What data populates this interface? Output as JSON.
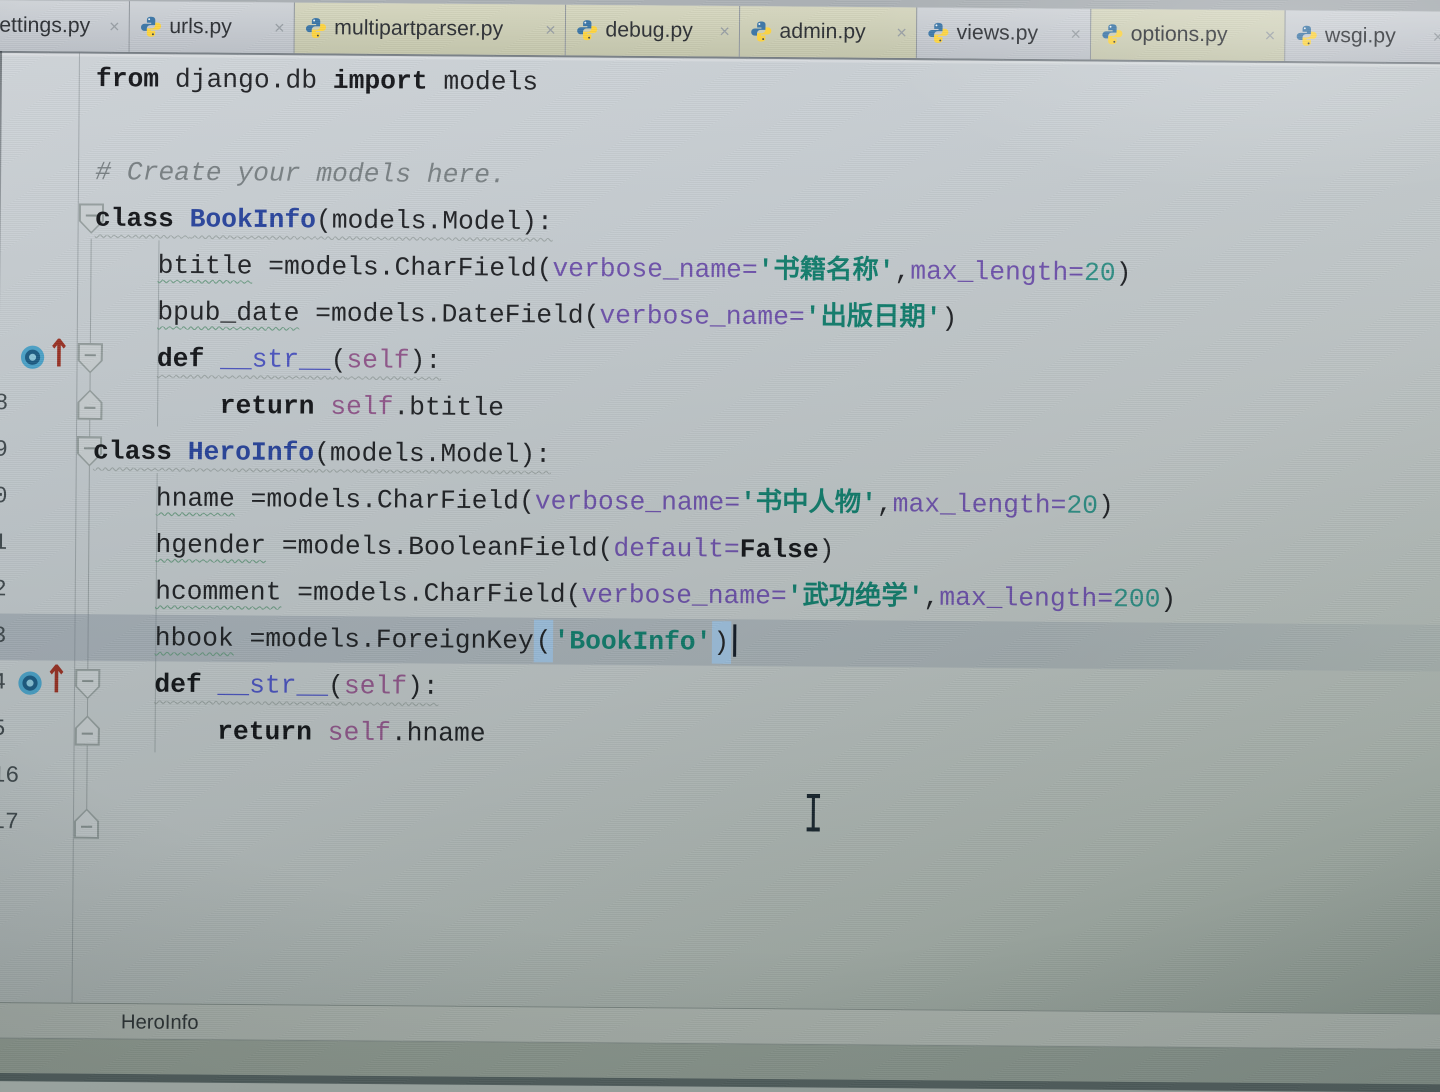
{
  "tabs": [
    {
      "label": "ettings.py",
      "icon": false,
      "tint": "gray",
      "close": "×"
    },
    {
      "label": "urls.py",
      "icon": true,
      "tint": "gray",
      "close": "×"
    },
    {
      "label": "multipartparser.py",
      "icon": true,
      "tint": "yellow",
      "close": "×"
    },
    {
      "label": "debug.py",
      "icon": true,
      "tint": "yellow",
      "close": "×"
    },
    {
      "label": "admin.py",
      "icon": true,
      "tint": "yellow",
      "close": "×"
    },
    {
      "label": "views.py",
      "icon": true,
      "tint": "gray",
      "close": "×"
    },
    {
      "label": "options.py",
      "icon": true,
      "tint": "yellow",
      "close": "×"
    },
    {
      "label": "wsgi.py",
      "icon": true,
      "tint": "gray",
      "close": "×"
    }
  ],
  "icons": {
    "override_arrow": "↑",
    "python_icon": "python-logo"
  },
  "editor": {
    "current_line": 13,
    "lines": [
      {
        "n": "",
        "i": 0,
        "tokens": [
          {
            "c": "kw",
            "t": "from"
          },
          {
            "c": "pl",
            "t": " django.db "
          },
          {
            "c": "kw",
            "t": "import"
          },
          {
            "c": "pl",
            "t": " models"
          }
        ]
      },
      {
        "n": "",
        "i": 0,
        "tokens": []
      },
      {
        "n": "",
        "i": 0,
        "tokens": [
          {
            "c": "cm",
            "t": "# Create your models here."
          }
        ]
      },
      {
        "n": "",
        "i": 0,
        "fold": "down",
        "sig": true,
        "tokens": [
          {
            "c": "kw",
            "t": "class "
          },
          {
            "c": "cls",
            "t": "BookInfo"
          },
          {
            "c": "pl",
            "t": "(models.Model):"
          }
        ]
      },
      {
        "n": "",
        "i": 4,
        "tokens": [
          {
            "c": "id",
            "t": "btitle"
          },
          {
            "c": "pl",
            "t": " =models.CharField("
          },
          {
            "c": "ar",
            "t": "verbose_name="
          },
          {
            "c": "st",
            "t": "'书籍名称'"
          },
          {
            "c": "pl",
            "t": ","
          },
          {
            "c": "ar",
            "t": "max_length="
          },
          {
            "c": "nu",
            "t": "20"
          },
          {
            "c": "pl",
            "t": ")"
          }
        ]
      },
      {
        "n": "",
        "i": 4,
        "tokens": [
          {
            "c": "id",
            "t": "bpub_date"
          },
          {
            "c": "pl",
            "t": " =models.DateField("
          },
          {
            "c": "ar",
            "t": "verbose_name="
          },
          {
            "c": "st",
            "t": "'出版日期'"
          },
          {
            "c": "pl",
            "t": ")"
          }
        ]
      },
      {
        "n": "",
        "i": 4,
        "fold": "down",
        "oicon": true,
        "sig": true,
        "tokens": [
          {
            "c": "kw",
            "t": "def "
          },
          {
            "c": "fn",
            "t": "__str__"
          },
          {
            "c": "pl",
            "t": "("
          },
          {
            "c": "sf",
            "t": "self"
          },
          {
            "c": "pl",
            "t": "):"
          }
        ]
      },
      {
        "n": "8",
        "i": 8,
        "fold": "up",
        "tokens": [
          {
            "c": "kw",
            "t": "return "
          },
          {
            "c": "sf",
            "t": "self"
          },
          {
            "c": "pl",
            "t": ".btitle"
          }
        ]
      },
      {
        "n": "9",
        "i": 0,
        "fold": "down",
        "sig": true,
        "tokens": [
          {
            "c": "kw",
            "t": "class "
          },
          {
            "c": "cls",
            "t": "HeroInfo"
          },
          {
            "c": "pl",
            "t": "(models.Model):"
          }
        ]
      },
      {
        "n": "0",
        "i": 4,
        "tokens": [
          {
            "c": "id",
            "t": "hname"
          },
          {
            "c": "pl",
            "t": " =models.CharField("
          },
          {
            "c": "ar",
            "t": "verbose_name="
          },
          {
            "c": "st",
            "t": "'书中人物'"
          },
          {
            "c": "pl",
            "t": ","
          },
          {
            "c": "ar",
            "t": "max_length="
          },
          {
            "c": "nu",
            "t": "20"
          },
          {
            "c": "pl",
            "t": ")"
          }
        ]
      },
      {
        "n": "1",
        "i": 4,
        "tokens": [
          {
            "c": "id",
            "t": "hgender"
          },
          {
            "c": "pl",
            "t": " =models.BooleanField("
          },
          {
            "c": "ar",
            "t": "default="
          },
          {
            "c": "kw",
            "t": "False"
          },
          {
            "c": "pl",
            "t": ")"
          }
        ]
      },
      {
        "n": "2",
        "i": 4,
        "tokens": [
          {
            "c": "id",
            "t": "hcomment"
          },
          {
            "c": "pl",
            "t": " =models.CharField("
          },
          {
            "c": "ar",
            "t": "verbose_name="
          },
          {
            "c": "st",
            "t": "'武功绝学'"
          },
          {
            "c": "pl",
            "t": ","
          },
          {
            "c": "ar",
            "t": "max_length="
          },
          {
            "c": "nu",
            "t": "200"
          },
          {
            "c": "pl",
            "t": ")"
          }
        ]
      },
      {
        "n": "3",
        "i": 4,
        "cur": true,
        "caret": true,
        "tokens": [
          {
            "c": "id",
            "t": "hbook"
          },
          {
            "c": "pl",
            "t": " =models.ForeignKey"
          },
          {
            "c": "hp",
            "t": "("
          },
          {
            "c": "st",
            "t": "'BookInfo'"
          },
          {
            "c": "hp",
            "t": ")"
          }
        ]
      },
      {
        "n": "4",
        "i": 4,
        "fold": "down",
        "oicon": true,
        "sig": true,
        "tokens": [
          {
            "c": "kw",
            "t": "def "
          },
          {
            "c": "fn",
            "t": "__str__"
          },
          {
            "c": "pl",
            "t": "("
          },
          {
            "c": "sf",
            "t": "self"
          },
          {
            "c": "pl",
            "t": "):"
          }
        ]
      },
      {
        "n": "5",
        "i": 8,
        "fold": "up",
        "tokens": [
          {
            "c": "kw",
            "t": "return "
          },
          {
            "c": "sf",
            "t": "self"
          },
          {
            "c": "pl",
            "t": ".hname"
          }
        ]
      },
      {
        "n": "16",
        "i": 0,
        "tokens": []
      },
      {
        "n": "17",
        "i": 0,
        "fold": "up",
        "tokens": []
      }
    ]
  },
  "breadcrumb": {
    "item": "HeroInfo"
  },
  "palette": {
    "string": "#0c7d6c",
    "number": "#2a8f85",
    "keyword_arg": "#6e4fae",
    "class_name": "#24409e",
    "self": "#94558d",
    "paren_match": "#a4c7e7",
    "tab_library_tint": "#c9cbae",
    "python_blue": "#3572a5",
    "python_yellow": "#ffd43b"
  }
}
